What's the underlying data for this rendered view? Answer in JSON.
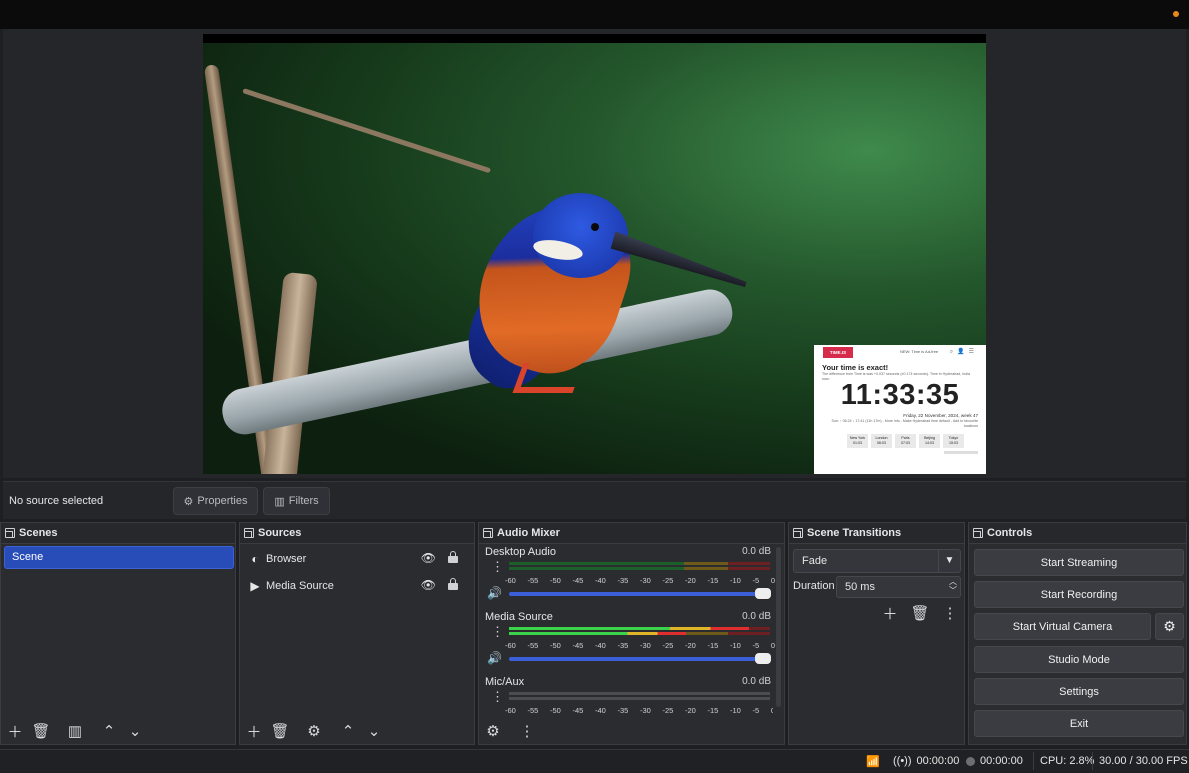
{
  "preview": {
    "overlay": {
      "logo": "TIME.IS",
      "nav": "NEW: Time is Ad-free",
      "heading": "Your time is exact!",
      "subtext": "The difference from Time.is was +0.037 seconds (±0.174 seconds). Time in Hyderabad, India now:",
      "clock": "11:33:35",
      "date": "Friday, 22 November, 2024, week 47",
      "sun": "Sun: ↑ 06:24 ↓ 17:41 (11h 17m) - More info - Make Hyderabad time default - Add to favourite locations",
      "cities": [
        {
          "name": "New York",
          "time": "01:03"
        },
        {
          "name": "London",
          "time": "06:03"
        },
        {
          "name": "Paris",
          "time": "07:03"
        },
        {
          "name": "Beijing",
          "time": "14:03"
        },
        {
          "name": "Tokyo",
          "time": "15:03"
        }
      ]
    }
  },
  "source_bar": {
    "selection_label": "No source selected",
    "properties_label": "Properties",
    "filters_label": "Filters"
  },
  "scenes": {
    "title": "Scenes",
    "items": [
      {
        "label": "Scene",
        "selected": true
      }
    ]
  },
  "sources": {
    "title": "Sources",
    "items": [
      {
        "label": "Browser",
        "type_icon": "globe-icon"
      },
      {
        "label": "Media Source",
        "type_icon": "play-icon"
      }
    ]
  },
  "audio_mixer": {
    "title": "Audio Mixer",
    "scale": [
      "-60",
      "-55",
      "-50",
      "-45",
      "-40",
      "-35",
      "-30",
      "-25",
      "-20",
      "-15",
      "-10",
      "-5",
      "0"
    ],
    "channels": [
      {
        "name": "Desktop Audio",
        "db": "0.0 dB",
        "level_top": 0,
        "level_bottom": 0,
        "volume": 1.0
      },
      {
        "name": "Media Source",
        "db": "0.0 dB",
        "level_top": 0.92,
        "level_bottom": 0.68,
        "volume": 1.0
      },
      {
        "name": "Mic/Aux",
        "db": "0.0 dB",
        "level_top": 0,
        "level_bottom": 0,
        "volume": 1.0,
        "muted": true
      }
    ]
  },
  "scene_transitions": {
    "title": "Scene Transitions",
    "transition": "Fade",
    "duration_label": "Duration",
    "duration_value": "50 ms"
  },
  "controls": {
    "title": "Controls",
    "start_streaming": "Start Streaming",
    "start_recording": "Start Recording",
    "start_virtual_camera": "Start Virtual Camera",
    "studio_mode": "Studio Mode",
    "settings": "Settings",
    "exit": "Exit"
  },
  "statusbar": {
    "stream_time": "00:00:00",
    "record_time": "00:00:00",
    "cpu": "CPU: 2.8%",
    "fps": "30.00 / 30.00 FPS"
  },
  "colors": {
    "accent": "#284cb8",
    "recording_indicator": "#e8871a",
    "meter_green": "#3bd34a",
    "meter_yellow": "#e0b528",
    "meter_red": "#e02e2e"
  }
}
